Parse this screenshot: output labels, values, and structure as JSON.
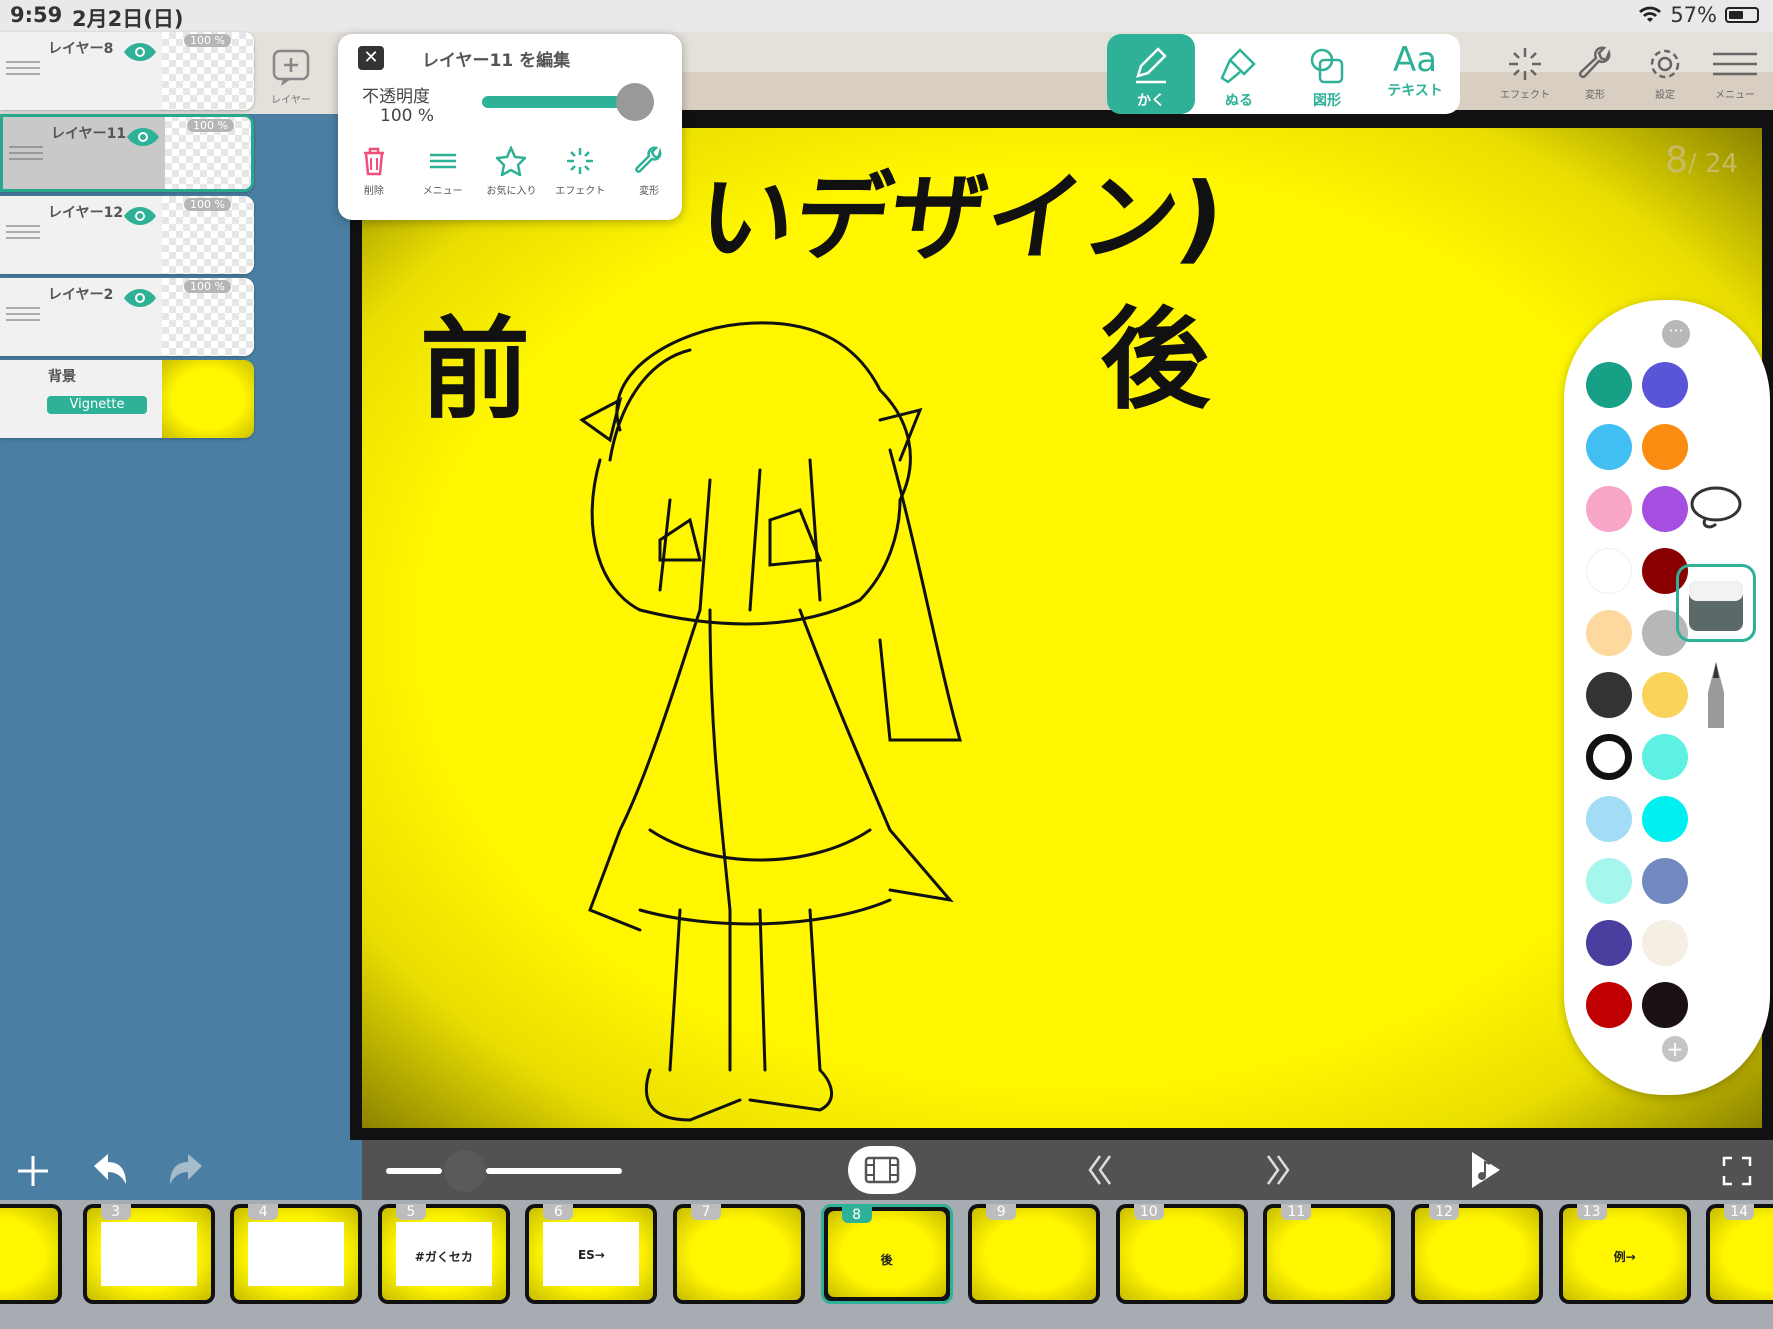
{
  "status_bar": {
    "time": "9:59",
    "date": "2月2日(日)",
    "battery": "57%"
  },
  "layers": [
    {
      "name": "レイヤー8",
      "opacity": "100 %",
      "selected": false
    },
    {
      "name": "レイヤー11",
      "opacity": "100 %",
      "selected": true
    },
    {
      "name": "レイヤー12",
      "opacity": "100 %",
      "selected": false
    },
    {
      "name": "レイヤー2",
      "opacity": "100 %",
      "selected": false
    },
    {
      "name": "背景",
      "tag": "Vignette",
      "selected": false
    }
  ],
  "add_layer_label": "レイヤー",
  "edit_popup": {
    "title": "レイヤー11 を編集",
    "opacity_label": "不透明度",
    "opacity_value": "100 %",
    "opacity_fraction": 1.0,
    "actions": [
      "削除",
      "メニュー",
      "お気に入り",
      "エフェクト",
      "変形"
    ]
  },
  "toolbar": {
    "tools": [
      "かく",
      "ぬる",
      "図形",
      "テキスト"
    ],
    "text_tool_glyph": "Aa",
    "active_tool": "かく",
    "right_tools": [
      "エフェクト",
      "変形",
      "設定",
      "メニュー"
    ]
  },
  "canvas": {
    "heading": "いデザイン)",
    "label_before": "前",
    "label_after": "後",
    "page_current": "8",
    "page_total": "/ 24"
  },
  "palette": {
    "colors_left": [
      "#16a085",
      "#42bff2",
      "#f7a6c8",
      "#ffffff",
      "#fdd9a0",
      "#333333",
      "#ffffff",
      "#a3dcf5",
      "#a5f6ec",
      "#4a3f9e",
      "#c00000"
    ],
    "colors_right": [
      "#5a55d6",
      "#fa8c12",
      "#a64ee0",
      "#8a0000",
      "#b7b7b7",
      "#fad45a",
      "#5ef0e2",
      "#00f0f0",
      "#7189bf",
      "#f5eee2",
      "#1a1212"
    ],
    "selected_color_index": 6,
    "brushes": [
      "lasso-brush",
      "eraser-brush",
      "pen-brush"
    ],
    "selected_brush": "eraser-brush"
  },
  "timeline": {
    "frames": [
      {
        "num": "",
        "text": ""
      },
      {
        "num": "3",
        "text": ""
      },
      {
        "num": "4",
        "text": ""
      },
      {
        "num": "5",
        "text": "#ガくセカ"
      },
      {
        "num": "6",
        "text": "ES→"
      },
      {
        "num": "7",
        "text": ""
      },
      {
        "num": "8",
        "text": "後",
        "current": true
      },
      {
        "num": "9",
        "text": ""
      },
      {
        "num": "10",
        "text": ""
      },
      {
        "num": "11",
        "text": ""
      },
      {
        "num": "12",
        "text": ""
      },
      {
        "num": "13",
        "text": "例→"
      },
      {
        "num": "14",
        "text": ""
      }
    ]
  }
}
